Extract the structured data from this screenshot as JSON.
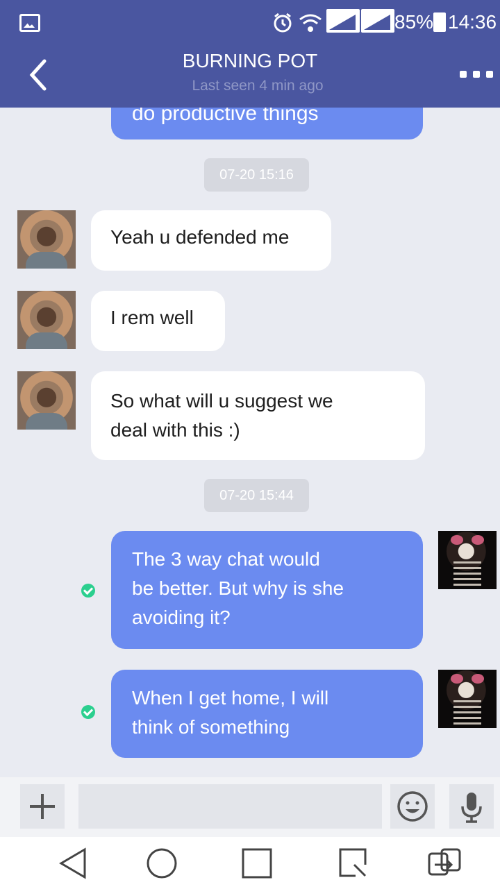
{
  "status_bar": {
    "battery": "85%",
    "time": "14:36",
    "icons": [
      "gallery-icon",
      "alarm-icon",
      "wifi-icon",
      "signal-icon",
      "signal-icon",
      "battery-icon"
    ]
  },
  "header": {
    "title": "BURNING POT",
    "subtitle": "Last seen 4 min ago"
  },
  "messages": [
    {
      "direction": "out",
      "text": "do productive things"
    },
    {
      "type": "timestamp",
      "text": "07-20 15:16"
    },
    {
      "direction": "in",
      "text": "Yeah u defended me"
    },
    {
      "direction": "in",
      "text": "I rem well"
    },
    {
      "direction": "in",
      "lines": [
        "So what will u suggest we",
        "deal with this :)"
      ]
    },
    {
      "type": "timestamp",
      "text": "07-20 15:44"
    },
    {
      "direction": "out",
      "status": "read",
      "lines": [
        "The 3 way chat would",
        "be better. But why is she",
        "avoiding it?"
      ]
    },
    {
      "direction": "out",
      "status": "read",
      "lines": [
        "When I get home, I will",
        "think of something"
      ]
    }
  ],
  "input": {
    "placeholder": "",
    "icons": [
      "plus-icon",
      "emoji-icon",
      "microphone-icon"
    ]
  },
  "nav_bar": {
    "icons": [
      "back-triangle-icon",
      "home-circle-icon",
      "recents-square-icon",
      "capture-icon",
      "dual-window-icon"
    ]
  },
  "colors": {
    "header": "#4a56a0",
    "outgoing_bubble": "#6b8bf0",
    "incoming_bubble": "#ffffff",
    "background": "#e9ebf2",
    "read_check": "#2bcf8f"
  }
}
